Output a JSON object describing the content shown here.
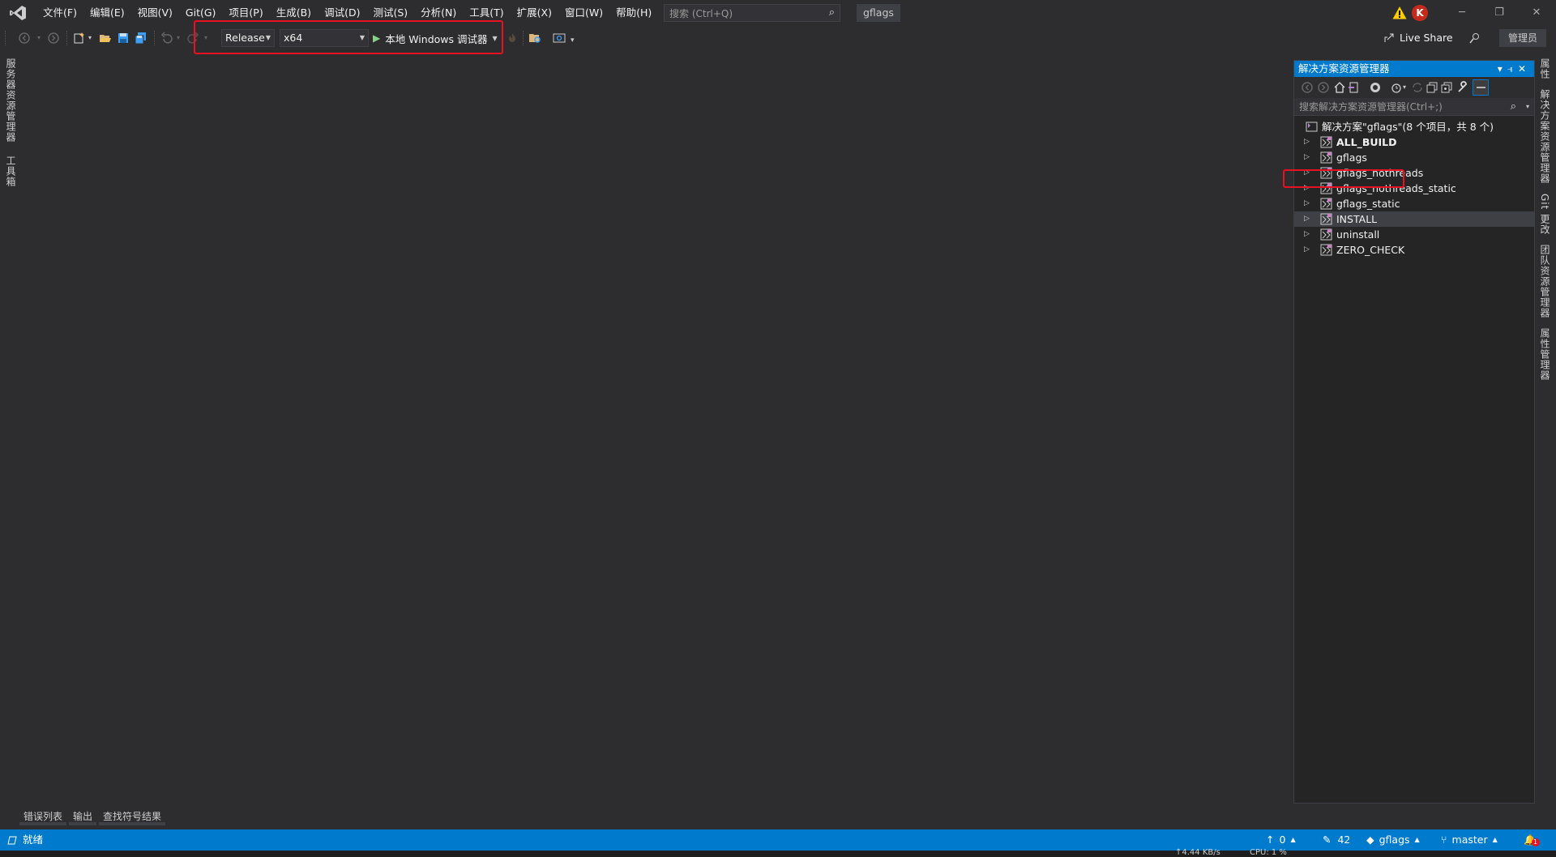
{
  "menu": {
    "items": [
      "文件(F)",
      "编辑(E)",
      "视图(V)",
      "Git(G)",
      "项目(P)",
      "生成(B)",
      "调试(D)",
      "测试(S)",
      "分析(N)",
      "工具(T)",
      "扩展(X)",
      "窗口(W)",
      "帮助(H)"
    ]
  },
  "search": {
    "placeholder": "搜索 (Ctrl+Q)"
  },
  "project_name": "gflags",
  "avatar_letter": "K",
  "toolbar": {
    "config": "Release",
    "platform": "x64",
    "run_label": "本地 Windows 调试器",
    "liveshare": "Live Share",
    "admin": "管理员"
  },
  "left_tabs": [
    "服务器资源管理器",
    "工具箱"
  ],
  "right_tabs": [
    "属性",
    "解决方案资源管理器",
    "Git 更改",
    "团队资源管理器",
    "属性管理器"
  ],
  "solution_explorer": {
    "title": "解决方案资源管理器",
    "search_placeholder": "搜索解决方案资源管理器(Ctrl+;)",
    "solution_label": "解决方案\"gflags\"(8 个项目，共 8 个)",
    "projects": [
      {
        "name": "ALL_BUILD",
        "bold": true
      },
      {
        "name": "gflags",
        "bold": false
      },
      {
        "name": "gflags_nothreads",
        "bold": false
      },
      {
        "name": "gflags_nothreads_static",
        "bold": false
      },
      {
        "name": "gflags_static",
        "bold": false
      },
      {
        "name": "INSTALL",
        "bold": false
      },
      {
        "name": "uninstall",
        "bold": false
      },
      {
        "name": "ZERO_CHECK",
        "bold": false
      }
    ],
    "selected_index": 5
  },
  "bottom_tabs": [
    "错误列表",
    "输出",
    "查找符号结果"
  ],
  "status": {
    "ready": "就绪",
    "up_count": "0",
    "pencil_count": "42",
    "repo": "gflags",
    "branch": "master",
    "notifications": "1"
  },
  "taskbar": {
    "net": "↑4.44 KB/s",
    "cpu": "CPU: 1 %"
  },
  "colors": {
    "accent": "#007acc",
    "background": "#2d2d30",
    "highlight_box": "#e81123"
  }
}
